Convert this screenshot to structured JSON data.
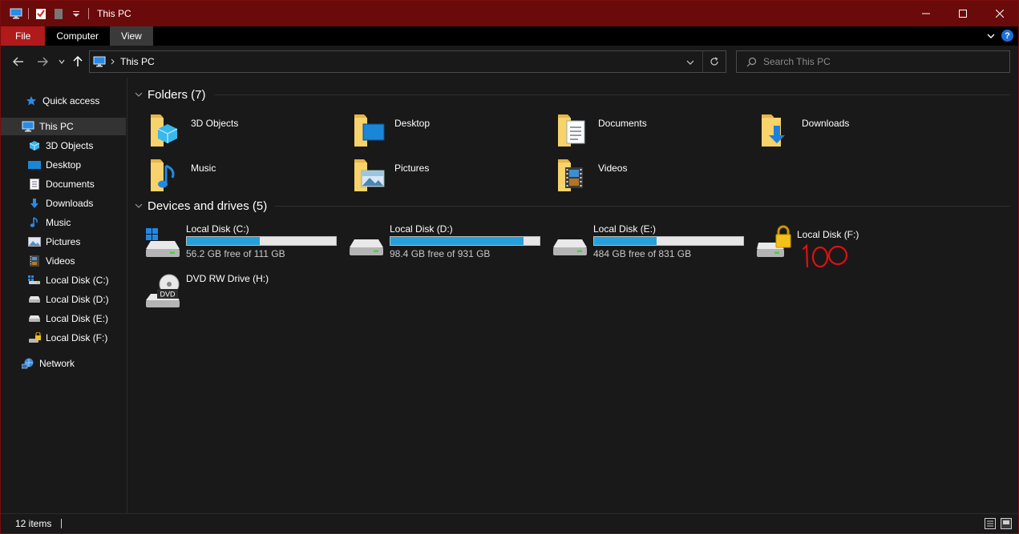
{
  "window": {
    "title": "This PC"
  },
  "ribbon": {
    "tabs": [
      {
        "label": "File"
      },
      {
        "label": "Computer"
      },
      {
        "label": "View"
      }
    ],
    "help": "?"
  },
  "address": {
    "path": "This PC"
  },
  "search": {
    "placeholder": "Search This PC"
  },
  "nav": {
    "items": [
      {
        "label": "Quick access",
        "icon": "star-icon"
      },
      {
        "label": "This PC",
        "icon": "computer-icon",
        "selected": true
      },
      {
        "label": "3D Objects",
        "icon": "cube-icon"
      },
      {
        "label": "Desktop",
        "icon": "desktop-icon"
      },
      {
        "label": "Documents",
        "icon": "document-icon"
      },
      {
        "label": "Downloads",
        "icon": "download-arrow-icon"
      },
      {
        "label": "Music",
        "icon": "music-note-icon"
      },
      {
        "label": "Pictures",
        "icon": "picture-icon"
      },
      {
        "label": "Videos",
        "icon": "film-icon"
      },
      {
        "label": "Local Disk (C:)",
        "icon": "windows-drive-icon"
      },
      {
        "label": "Local Disk (D:)",
        "icon": "drive-icon"
      },
      {
        "label": "Local Disk (E:)",
        "icon": "drive-icon"
      },
      {
        "label": "Local Disk (F:)",
        "icon": "locked-drive-icon"
      },
      {
        "label": "Network",
        "icon": "network-icon"
      }
    ]
  },
  "folders": {
    "header": "Folders (7)",
    "items": [
      {
        "label": "3D Objects",
        "icon": "3d-objects-folder-icon"
      },
      {
        "label": "Desktop",
        "icon": "desktop-folder-icon"
      },
      {
        "label": "Documents",
        "icon": "documents-folder-icon"
      },
      {
        "label": "Downloads",
        "icon": "downloads-folder-icon"
      },
      {
        "label": "Music",
        "icon": "music-folder-icon"
      },
      {
        "label": "Pictures",
        "icon": "pictures-folder-icon"
      },
      {
        "label": "Videos",
        "icon": "videos-folder-icon"
      }
    ]
  },
  "drives": {
    "header": "Devices and drives (5)",
    "items": [
      {
        "label": "Local Disk (C:)",
        "free": "56.2 GB free of 111 GB",
        "used_fraction": 0.49
      },
      {
        "label": "Local Disk (D:)",
        "free": "98.4 GB free of 931 GB",
        "used_fraction": 0.89
      },
      {
        "label": "Local Disk (E:)",
        "free": "484 GB free of 831 GB",
        "used_fraction": 0.42
      },
      {
        "label": "Local Disk (F:)",
        "locked": true
      },
      {
        "label": "DVD RW Drive (H:)",
        "icon_text": "DVD"
      }
    ]
  },
  "annotation": {
    "text": "100",
    "color": "#e01010"
  },
  "status": {
    "count": "12 items"
  },
  "colors": {
    "titlebar": "#6b0a0a",
    "file_tab": "#b01a1a",
    "accent_bar": "#26a0da",
    "background": "#191919"
  }
}
